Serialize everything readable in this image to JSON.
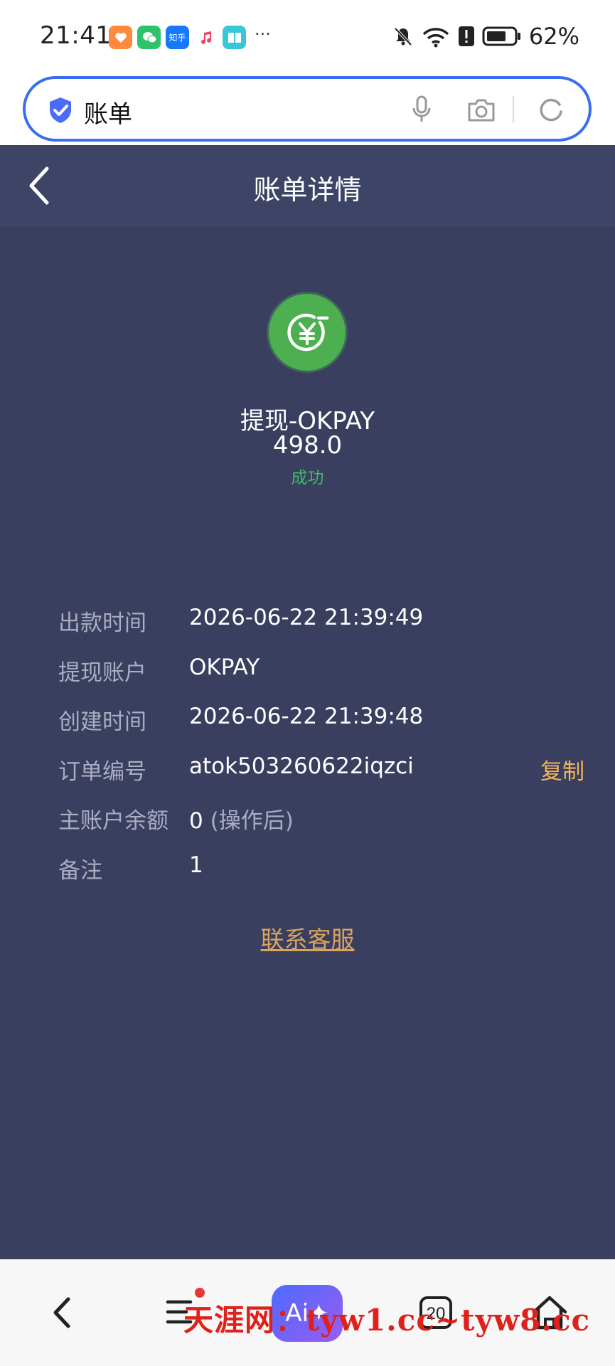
{
  "status_bar": {
    "time": "21:41",
    "more": "···",
    "battery": "62%",
    "icons": [
      "orange-app-icon",
      "wechat-icon",
      "zhihu-icon",
      "music-icon",
      "reader-icon",
      "mute-icon",
      "wifi-icon",
      "alert-icon",
      "battery-icon"
    ],
    "zhihu_label": "知乎"
  },
  "search": {
    "text": "账单"
  },
  "header": {
    "title": "账单详情"
  },
  "transaction": {
    "title": "提现-OKPAY",
    "amount": "498.0",
    "status": "成功",
    "status_color": "#3bbf6a",
    "icon": "yen-withdraw-icon",
    "icon_color": "#4caf50"
  },
  "details": [
    {
      "label": "出款时间",
      "value": "2026-06-22 21:39:49"
    },
    {
      "label": "提现账户",
      "value": "OKPAY"
    },
    {
      "label": "创建时间",
      "value": "2026-06-22 21:39:48"
    },
    {
      "label": "订单编号",
      "value": "atok503260622iqzci",
      "action": "复制"
    },
    {
      "label": "主账户余额",
      "value": "0",
      "note": "(操作后)"
    },
    {
      "label": "备注",
      "value": "1"
    }
  ],
  "contact": {
    "label": "联系客服"
  },
  "bottom_nav": {
    "ai_label": "Ai✦",
    "tabs_count": "20",
    "watermark": "天涯网：tyw1.cc~tyw8.cc"
  },
  "colors": {
    "page_bg": "#3a3e5f",
    "header_bg": "#3d4466",
    "accent_gold": "#f1b45a",
    "search_border": "#3a6df0"
  }
}
